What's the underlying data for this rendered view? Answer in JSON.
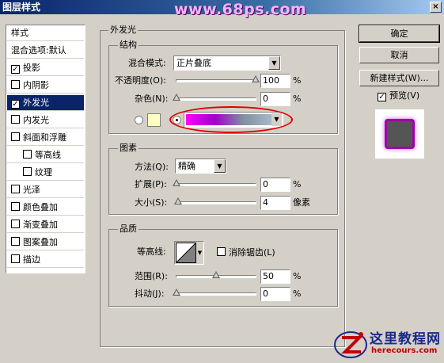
{
  "window": {
    "title": "图层样式",
    "close_label": "×"
  },
  "watermark": "www.68ps.com",
  "styles_panel": {
    "header": "样式",
    "items": [
      {
        "label": "混合选项:默认",
        "checkbox": false,
        "checked": false
      },
      {
        "label": "投影",
        "checkbox": true,
        "checked": true
      },
      {
        "label": "内阴影",
        "checkbox": true,
        "checked": false
      },
      {
        "label": "外发光",
        "checkbox": true,
        "checked": true,
        "selected": true
      },
      {
        "label": "内发光",
        "checkbox": true,
        "checked": false
      },
      {
        "label": "斜面和浮雕",
        "checkbox": true,
        "checked": false
      },
      {
        "label": "等高线",
        "checkbox": true,
        "checked": false,
        "sub": true
      },
      {
        "label": "纹理",
        "checkbox": true,
        "checked": false,
        "sub": true
      },
      {
        "label": "光泽",
        "checkbox": true,
        "checked": false
      },
      {
        "label": "颜色叠加",
        "checkbox": true,
        "checked": false
      },
      {
        "label": "渐变叠加",
        "checkbox": true,
        "checked": false
      },
      {
        "label": "图案叠加",
        "checkbox": true,
        "checked": false
      },
      {
        "label": "描边",
        "checkbox": true,
        "checked": false
      }
    ]
  },
  "outer_glow": {
    "title": "外发光",
    "structure": {
      "title": "结构",
      "blend_mode_label": "混合模式:",
      "blend_mode_value": "正片叠底",
      "opacity_label": "不透明度(O):",
      "opacity_value": "100",
      "opacity_unit": "%",
      "opacity_level": 1.0,
      "noise_label": "杂色(N):",
      "noise_value": "0",
      "noise_unit": "%",
      "noise_level": 0.0,
      "glow_mode": "gradient",
      "solid_color": "#ffffc0",
      "gradient_colors": [
        "#ff00ff",
        "#a000c8",
        "#8090a0",
        "#a8b8c8"
      ]
    },
    "elements": {
      "title": "图素",
      "technique_label": "方法(Q):",
      "technique_value": "精确",
      "spread_label": "扩展(P):",
      "spread_value": "0",
      "spread_unit": "%",
      "spread_level": 0.0,
      "size_label": "大小(S):",
      "size_value": "4",
      "size_unit": "像素",
      "size_level": 0.02
    },
    "quality": {
      "title": "品质",
      "contour_label": "等高线:",
      "antialias_label": "消除锯齿(L)",
      "antialias_checked": false,
      "range_label": "范围(R):",
      "range_value": "50",
      "range_unit": "%",
      "range_level": 0.5,
      "jitter_label": "抖动(J):",
      "jitter_value": "0",
      "jitter_unit": "%",
      "jitter_level": 0.0
    }
  },
  "buttons": {
    "ok": "确定",
    "cancel": "取消",
    "new_style": "新建样式(W)...",
    "preview_label": "预览(V)",
    "preview_checked": true
  },
  "preview_colors": {
    "fill": "#555555",
    "stroke": "#a000a8"
  },
  "site_logo": {
    "text_cn": "这里教程网",
    "text_en": "herecours.com"
  },
  "highlight_color": "#e00000"
}
